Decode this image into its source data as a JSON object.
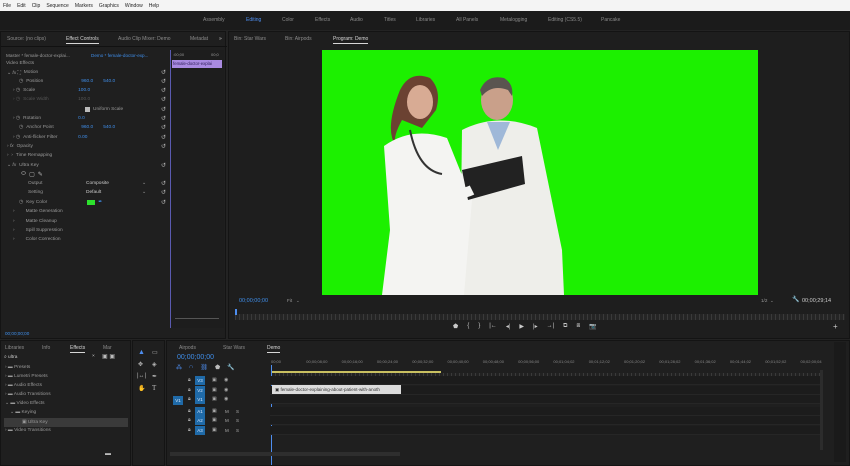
{
  "menu": [
    "File",
    "Edit",
    "Clip",
    "Sequence",
    "Markers",
    "Graphics",
    "Window",
    "Help"
  ],
  "workspaces": [
    "Assembly",
    "Editing",
    "Color",
    "Effects",
    "Audio",
    "Titles",
    "Libraries",
    "All Panels",
    "Metalogging",
    "Editing (CS5.5)",
    "Pancake"
  ],
  "source_tabs": {
    "source": "Source: (no clips)",
    "effect_controls": "Effect Controls",
    "audio_mixer": "Audio Clip Mixer: Demo",
    "metadata": "Metadat"
  },
  "program_tabs": {
    "bin1": "Bin: Star Wars",
    "bin2": "Bin: Airpods",
    "program": "Program: Demo"
  },
  "effect_controls": {
    "master": "Master * female-doctor-explai...",
    "clip": "Demo * female-doctor-exp...",
    "mini_time_start": ":00;00",
    "mini_time_end": "00;0",
    "mini_clip": "female-doctor-explai",
    "video_effects": "Video Effects",
    "motion": "Motion",
    "position_label": "Position",
    "position_x": "960.0",
    "position_y": "540.0",
    "scale_label": "Scale",
    "scale": "100.0",
    "scale_width_label": "Scale Width",
    "scale_width": "100.0",
    "uniform_scale": "Uniform Scale",
    "rotation_label": "Rotation",
    "rotation": "0.0",
    "anchor_label": "Anchor Point",
    "anchor_x": "960.0",
    "anchor_y": "540.0",
    "flicker_label": "Anti-flicker Filter",
    "flicker": "0.00",
    "opacity": "Opacity",
    "time_remap": "Time Remapping",
    "ultra_key": "Ultra Key",
    "output_label": "Output",
    "output": "Composite",
    "setting_label": "Setting",
    "setting": "Default",
    "key_color_label": "Key Color",
    "key_color": "#2de12d",
    "matte_gen": "Matte Generation",
    "matte_clean": "Matte Cleanup",
    "spill": "Spill Suppression",
    "color_corr": "Color Correction",
    "timecode": "00;00;00;00"
  },
  "program": {
    "timecode": "00;00;00;00",
    "fit": "Fit",
    "res": "1/2",
    "duration": "00;00;29;14",
    "screen_color": "#1cf000"
  },
  "effects_panel": {
    "tabs": [
      "Libraries",
      "Info",
      "Effects",
      "Mar"
    ],
    "search": "ultra",
    "items": [
      "Presets",
      "Lumetri Presets",
      "Audio Effects",
      "Audio Transitions",
      "Video Effects",
      "Keying",
      "Ultra Key",
      "Video Transitions"
    ]
  },
  "timeline": {
    "tabs": [
      "Airpods",
      "Star Wars",
      "Demo"
    ],
    "timecode": "00;00;00;00",
    "ruler": [
      "00;00",
      "00;00;08;00",
      "00;00;16;00",
      "00;00;24;00",
      "00;00;32;00",
      "00;00;40;00",
      "00;00;48;00",
      "00;00;56;00",
      "00;01;04;02",
      "00;01;12;02",
      "00;01;20;02",
      "00;01;28;02",
      "00;01;36;02",
      "00;01;44;02",
      "00;01;52;02",
      "00;02;00;04"
    ],
    "tracks": [
      "V3",
      "V2",
      "V1",
      "A1",
      "A2",
      "A3"
    ],
    "source_patch": "V1",
    "clip": "female-doctor-explaining-about-patient-with-anoth",
    "m": "M",
    "s": "S"
  }
}
